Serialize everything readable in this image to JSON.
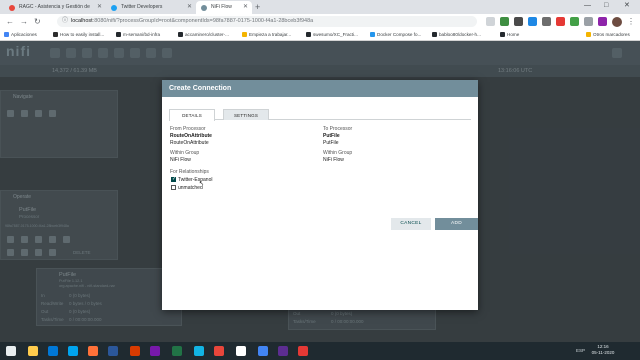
{
  "browser": {
    "tabs": [
      {
        "label": "RAGC - Asistencia y Gestión de",
        "fav": "#e8463b"
      },
      {
        "label": "Twitter Developers",
        "fav": "#1da1f2"
      },
      {
        "label": "NiFi Flow",
        "fav": "#728e9b"
      }
    ],
    "new_tab": "+",
    "win_controls": [
      "—",
      "□",
      "✕"
    ],
    "url_host": "localhost",
    "url_rest": ":8080/nifi/?processGroupId=root&componentIds=98fa7887-0175-1000-f4a1-28bceb3f948a",
    "bookmarks": [
      {
        "label": "Aplicaciones",
        "color": "#4285f4"
      },
      {
        "label": "How to easily install...",
        "color": "#2d2d2d"
      },
      {
        "label": "m-semani/bd-infra",
        "color": "#24292e"
      },
      {
        "label": "accaminero/cluster-...",
        "color": "#24292e"
      },
      {
        "label": "Empieza a trabajar...",
        "color": "#f4b400"
      },
      {
        "label": "swesumo/XC_Fracti...",
        "color": "#24292e"
      },
      {
        "label": "Docker Compose fo...",
        "color": "#2496ed"
      },
      {
        "label": "babloo80/docker-h...",
        "color": "#24292e"
      },
      {
        "label": "Home",
        "color": "#24292e"
      },
      {
        "label": "Otros marcadores",
        "color": "#f4b400"
      }
    ]
  },
  "nifi": {
    "logo": "nifi",
    "status_counts": "14,372 / 61.39 MB",
    "status_time": "13:16:06 UTC",
    "navigate_title": "Navigate",
    "operate_title": "Operate",
    "operate_name": "PutFile",
    "operate_type": "Processor",
    "operate_id": "98fa7887-0175-1000-f4a1-28bceb3f948a",
    "delete_label": "DELETE",
    "card": {
      "name": "PutFile",
      "type": "PutFile 1.12.1",
      "bundle": "org.apache.nifi - nifi-standard-nar",
      "rows": [
        {
          "k": "In",
          "v": "0 (0 bytes)"
        },
        {
          "k": "Read/Write",
          "v": "0 bytes / 0 bytes"
        },
        {
          "k": "Out",
          "v": "0 (0 bytes)"
        },
        {
          "k": "Tasks/Time",
          "v": "0 / 00:00:00.000"
        }
      ]
    },
    "card2": {
      "rows": [
        {
          "k": "Out",
          "v": "0 (0 bytes)"
        },
        {
          "k": "Tasks/Time",
          "v": "0 / 00:00:00.000"
        }
      ]
    }
  },
  "modal": {
    "title": "Create Connection",
    "tabs": [
      "DETAILS",
      "SETTINGS"
    ],
    "from_processor_label": "From Processor",
    "from_processor_name": "RouteOnAttribute",
    "from_processor_type": "RouteOnAttribute",
    "to_processor_label": "To Processor",
    "to_processor_name": "PutFile",
    "to_processor_type": "PutFile",
    "from_group_label": "Within Group",
    "from_group_value": "NiFi Flow",
    "to_group_label": "Within Group",
    "to_group_value": "NiFi Flow",
    "relationships_label": "For Relationships",
    "relationships": [
      {
        "label": "Twitter-Espanol",
        "checked": true
      },
      {
        "label": "unmatched",
        "checked": false
      }
    ],
    "cancel": "CANCEL",
    "add": "ADD"
  },
  "taskbar": {
    "lang": "ESP",
    "time": "12:16",
    "date": "05-11-2020",
    "apps": [
      "#e8eef0",
      "#ffcc4d",
      "#0078d7",
      "#00a4ef",
      "#ff7139",
      "#2b579a",
      "#d83b01",
      "#7719aa",
      "#217346",
      "#12b4e4",
      "#e8463b",
      "#ffffff",
      "#4285f4",
      "#5c2d91",
      "#e53935"
    ]
  }
}
